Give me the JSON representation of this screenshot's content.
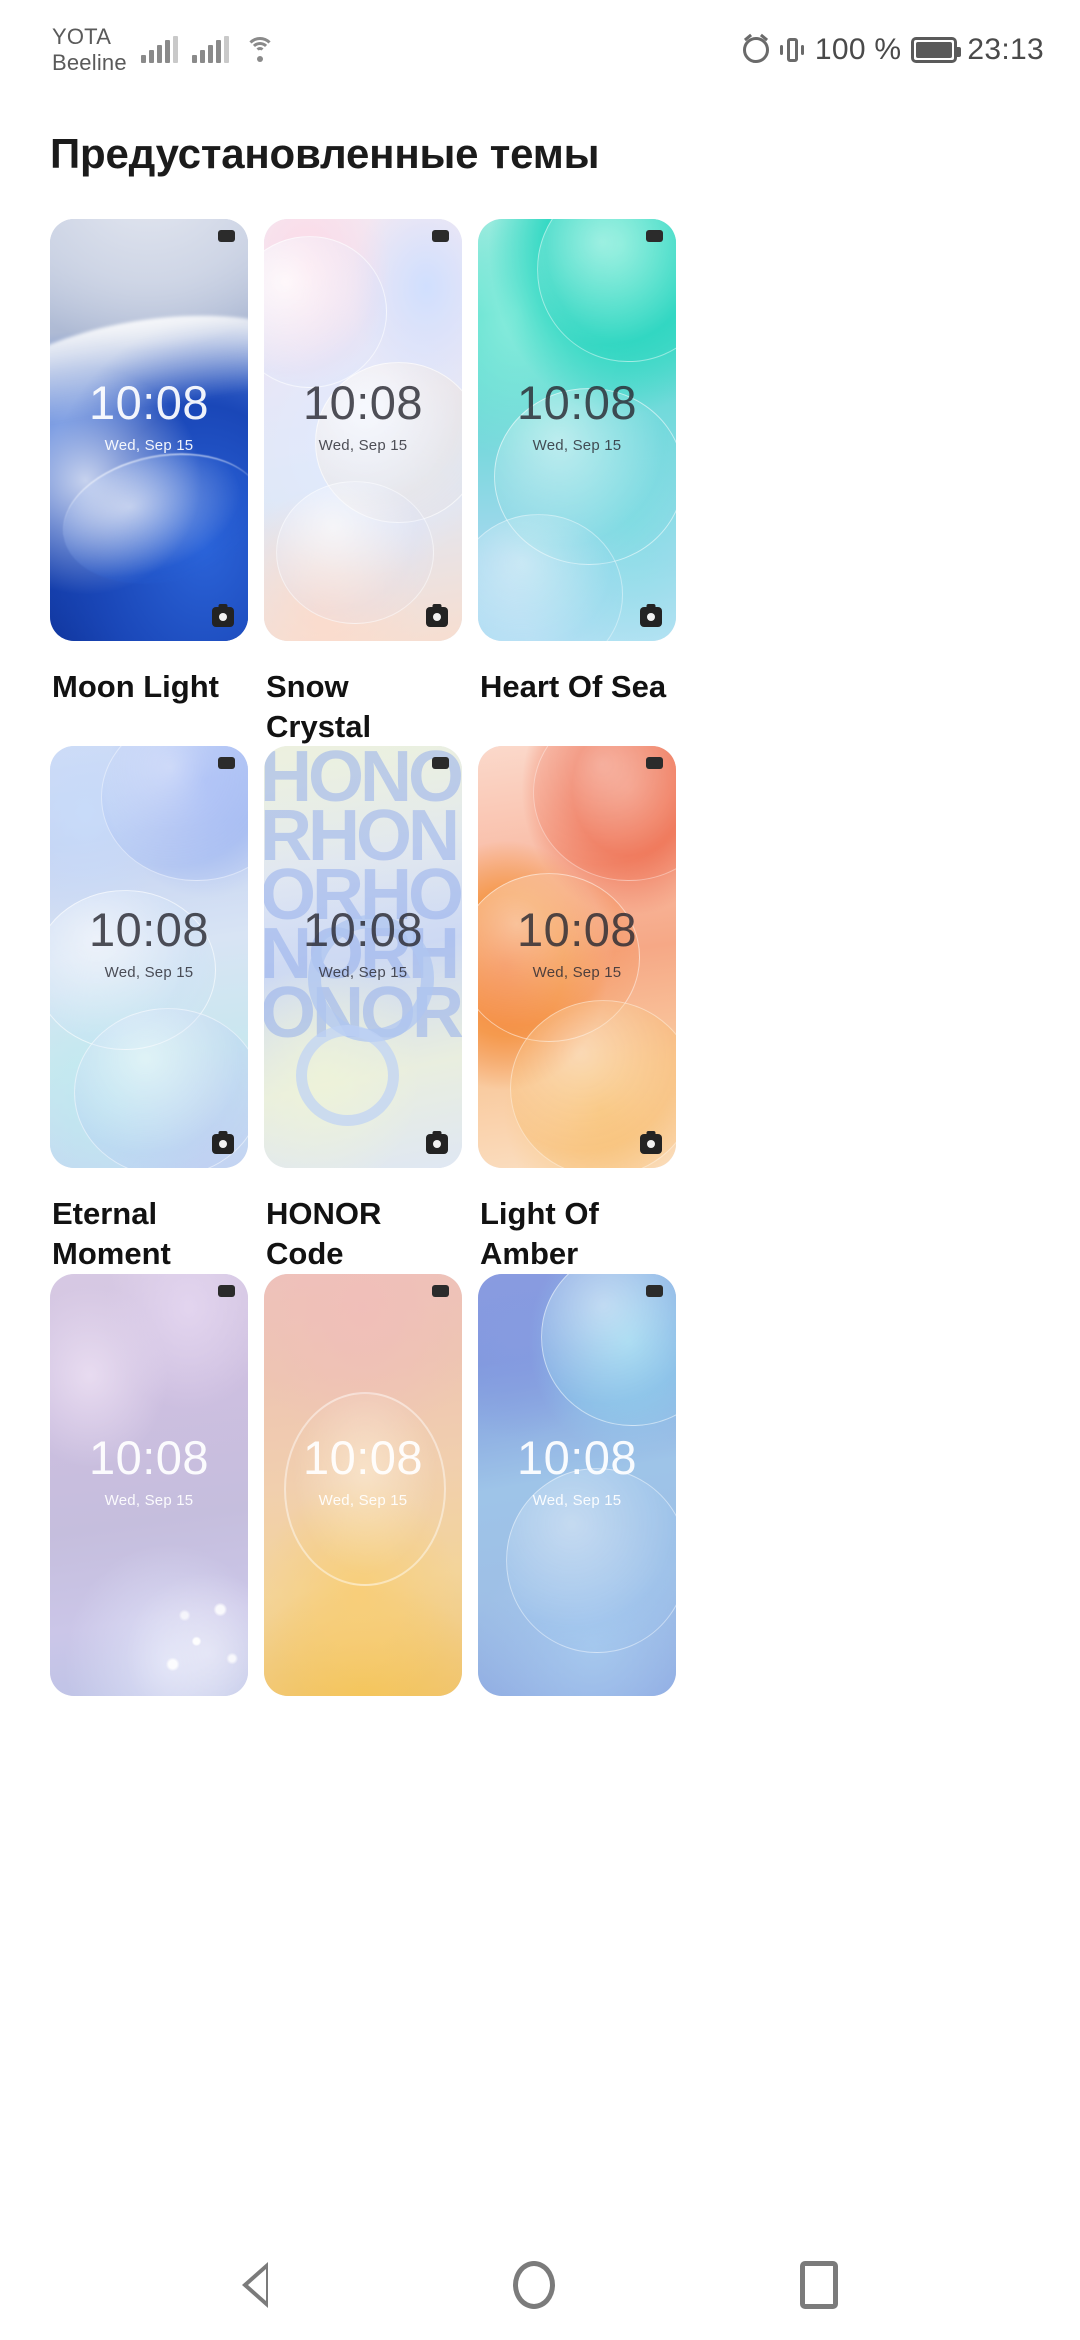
{
  "status_bar": {
    "carrier_1": "YOTA",
    "carrier_2": "Beeline",
    "battery_percent": "100 %",
    "time": "23:13",
    "icons": [
      "signal-bars-icon",
      "signal-bars-icon",
      "wifi-icon",
      "alarm-icon",
      "vibrate-icon",
      "battery-icon"
    ]
  },
  "header": {
    "title": "Предустановленные темы"
  },
  "lockscreen_preview": {
    "clock": "10:08",
    "date": "Wed, Sep 15",
    "camera_shortcut_icon": "camera-icon"
  },
  "themes": [
    {
      "name": "Moon Light",
      "art": "art-moon-light",
      "text": "light-text",
      "row": 1
    },
    {
      "name": "Snow Crystal",
      "art": "art-snow-crystal",
      "text": "dark-text",
      "row": 1
    },
    {
      "name": "Heart Of Sea",
      "art": "art-heart-of-sea",
      "text": "dark-text",
      "row": 1
    },
    {
      "name": "Eternal Moment",
      "art": "art-eternal-moment",
      "text": "dark-text",
      "row": 2
    },
    {
      "name": "HONOR Code",
      "art": "art-honor-code",
      "text": "dark-text",
      "row": 2
    },
    {
      "name": "Light Of Amber",
      "art": "art-light-of-amber",
      "text": "dark-text",
      "row": 2
    },
    {
      "name": "",
      "art": "art-crystal",
      "text": "light-text",
      "row": 3
    },
    {
      "name": "",
      "art": "art-sand",
      "text": "light-text",
      "row": 3
    },
    {
      "name": "",
      "art": "art-prism",
      "text": "light-text",
      "row": 3
    }
  ],
  "honor_code_letters": [
    "HONO",
    "RHON",
    "ORHO",
    "NORH",
    "ONOR"
  ],
  "nav_bar": {
    "back_label": "Back",
    "home_label": "Home",
    "recents_label": "Recents"
  },
  "colors": {
    "background": "#ffffff",
    "title_text": "#1b1b1b",
    "status_text": "#4a4a4a",
    "nav_icon": "#7b7b7b"
  }
}
